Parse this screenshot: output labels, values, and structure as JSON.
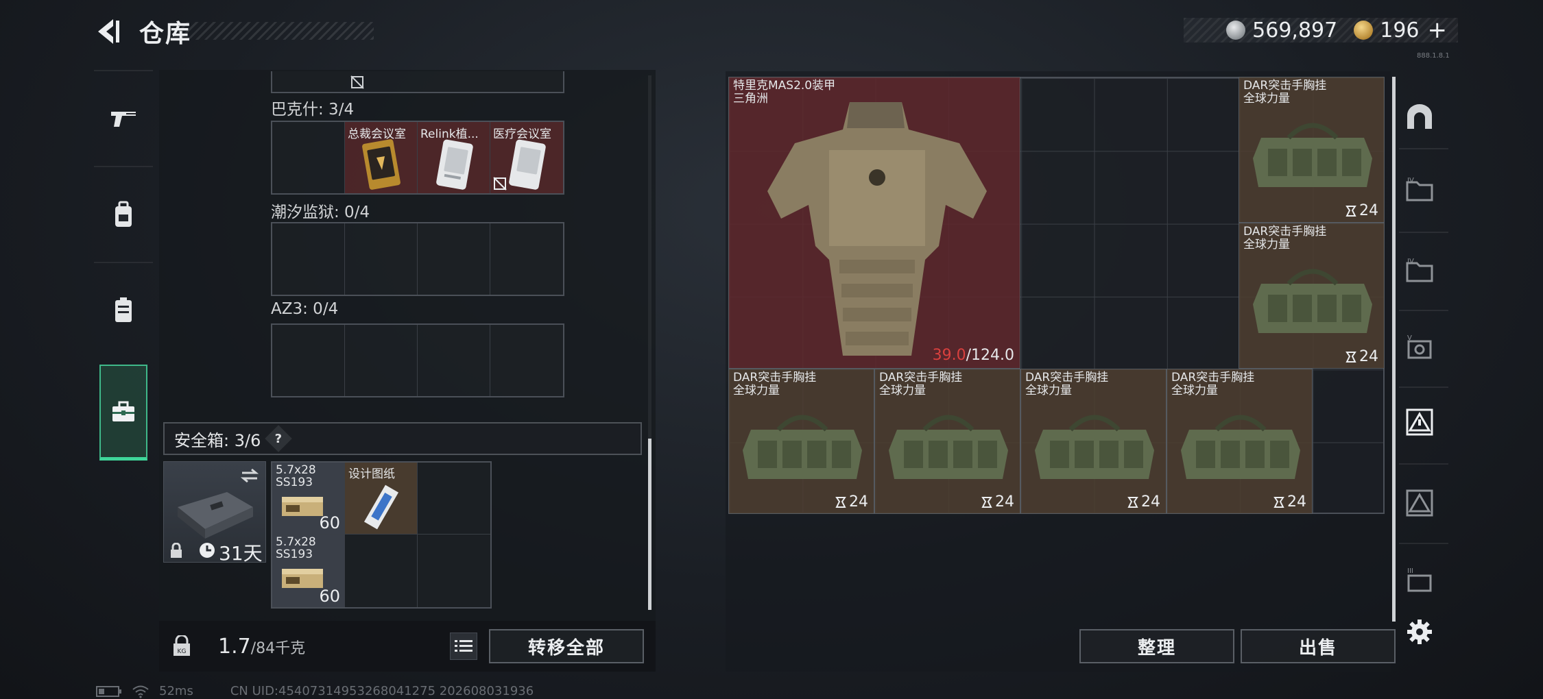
{
  "header": {
    "title": "仓库",
    "silver_amount": "569,897",
    "gold_amount": "196",
    "add_symbol": "+",
    "small_code": "888.1.8.1"
  },
  "sections": [
    {
      "label": "巴克什: 3/4",
      "items": [
        {
          "name": "总裁会议室",
          "type": "card-gold"
        },
        {
          "name": "Relink植...",
          "type": "card-silver"
        },
        {
          "name": "医疗会议室",
          "type": "card-silver"
        }
      ]
    },
    {
      "label": "潮汐监狱: 0/4",
      "items": []
    },
    {
      "label": "AZ3: 0/4",
      "items": []
    }
  ],
  "safebox": {
    "label": "安全箱: 3/6",
    "help": "?",
    "duration": "31天",
    "items": [
      {
        "name": "5.7x28\nSS193",
        "count": "60"
      },
      {
        "name": "设计图纸",
        "count": ""
      },
      {
        "name": "5.7x28\nSS193",
        "count": "60"
      }
    ]
  },
  "bottom_left": {
    "weight_current": "1.7",
    "weight_max": "/84千克",
    "transfer_all": "转移全部"
  },
  "stash": {
    "armor": {
      "name": "特里克MAS2.0装甲\n三角洲",
      "durability_current": "39.0",
      "durability_max": "/124.0"
    },
    "rigs": [
      {
        "name": "DAR突击手胸挂\n全球力量",
        "count": "24"
      },
      {
        "name": "DAR突击手胸挂\n全球力量",
        "count": "24"
      },
      {
        "name": "DAR突击手胸挂\n全球力量",
        "count": "24"
      },
      {
        "name": "DAR突击手胸挂\n全球力量",
        "count": "24"
      },
      {
        "name": "DAR突击手胸挂\n全球力量",
        "count": "24"
      },
      {
        "name": "DAR突击手胸挂\n全球力量",
        "count": "24"
      }
    ],
    "sort_button": "整理",
    "sell_button": "出售"
  },
  "status_bar": {
    "ping": "52ms",
    "uid": "CN UID:454073149532680412​75  202608031936"
  },
  "colors": {
    "accent_green": "#3fd69a",
    "durability_red": "#d9403e",
    "armor_bg": "#5f282d",
    "rig_bg": "#4e3e30"
  },
  "icons": {
    "left_tabs": [
      "pistol-icon",
      "backpack-icon",
      "chest-rig-icon",
      "toolbox-icon"
    ],
    "right_tabs": [
      "arch-icon",
      "folder-iv-icon",
      "folder-iv-icon",
      "vault-v-icon",
      "warning-box-icon",
      "warning-box-icon",
      "crate-iii-icon",
      "gear-icon"
    ]
  }
}
